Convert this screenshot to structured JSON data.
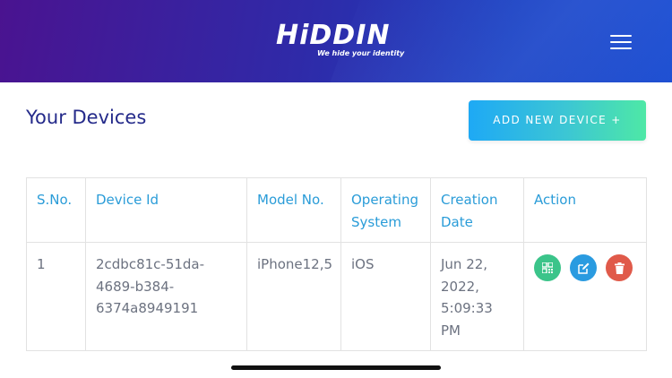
{
  "header": {
    "logo_text": "HiDDIN",
    "logo_tagline": "We hide your identity",
    "menu_icon": "hamburger-menu-icon",
    "gradient_colors": [
      "#4a1390",
      "#1a4cd0"
    ]
  },
  "page": {
    "title": "Your Devices",
    "add_button_label": "ADD NEW DEVICE +"
  },
  "table": {
    "headers": {
      "sno": "S.No.",
      "device_id": "Device Id",
      "model_no": "Model No.",
      "os": "Operating System",
      "creation_date": "Creation Date",
      "action": "Action"
    },
    "rows": [
      {
        "sno": "1",
        "device_id": "2cdbc81c-51da-4689-b384-6374a8949191",
        "model_no": "iPhone12,5",
        "os": "iOS",
        "creation_date": "Jun 22, 2022, 5:09:33 PM",
        "actions": [
          {
            "icon": "qr-code-icon",
            "color": "#3bc48a"
          },
          {
            "icon": "edit-icon",
            "color": "#2a9be0"
          },
          {
            "icon": "trash-icon",
            "color": "#e05a4a"
          }
        ]
      }
    ]
  },
  "colors": {
    "title": "#242a8a",
    "table_header": "#2a9cd8",
    "table_text": "#6c7280",
    "button_gradient": [
      "#1ea9f5",
      "#4ee8a6"
    ]
  }
}
